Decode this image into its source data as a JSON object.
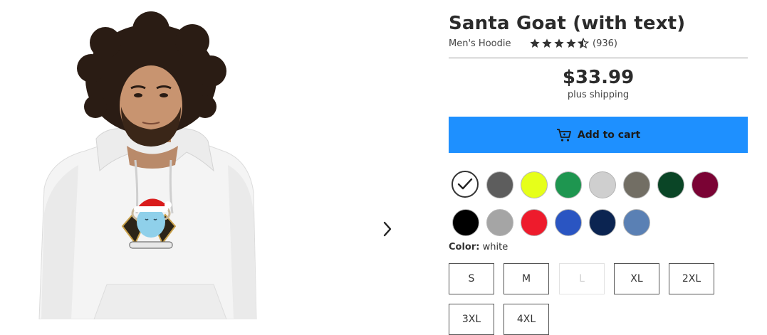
{
  "product": {
    "title": "Santa Goat (with text)",
    "type": "Men's Hoodie",
    "rating": 4.5,
    "review_count": "(936)",
    "price": "$33.99",
    "shipping": "plus shipping"
  },
  "actions": {
    "add_to_cart": "Add to cart"
  },
  "colors": {
    "label": "Color:",
    "selected": "white",
    "swatches": [
      {
        "name": "white",
        "hex": "#ffffff"
      },
      {
        "name": "charcoal",
        "hex": "#5d5d5d"
      },
      {
        "name": "neon yellow",
        "hex": "#e6ff1a"
      },
      {
        "name": "kelly green",
        "hex": "#1e9650"
      },
      {
        "name": "light gray",
        "hex": "#cfcfcf"
      },
      {
        "name": "taupe",
        "hex": "#726e64"
      },
      {
        "name": "forest green",
        "hex": "#0a4526"
      },
      {
        "name": "burgundy",
        "hex": "#7a0334"
      },
      {
        "name": "black",
        "hex": "#000000"
      },
      {
        "name": "heather gray",
        "hex": "#a5a5a5"
      },
      {
        "name": "red",
        "hex": "#ee1b2c"
      },
      {
        "name": "royal blue",
        "hex": "#2a55c2"
      },
      {
        "name": "navy",
        "hex": "#0b2451"
      },
      {
        "name": "denim blue",
        "hex": "#5a80b4"
      }
    ]
  },
  "sizes": [
    {
      "label": "S",
      "available": true
    },
    {
      "label": "M",
      "available": true
    },
    {
      "label": "L",
      "available": false
    },
    {
      "label": "XL",
      "available": true
    },
    {
      "label": "2XL",
      "available": true
    },
    {
      "label": "3XL",
      "available": true
    },
    {
      "label": "4XL",
      "available": true
    }
  ],
  "icons": {
    "next": "chevron-right-icon",
    "cart": "cart-icon",
    "check": "checkmark-icon",
    "star": "star-icon"
  },
  "theme": {
    "accent": "#1e90ff",
    "text": "#2b2b2b"
  }
}
